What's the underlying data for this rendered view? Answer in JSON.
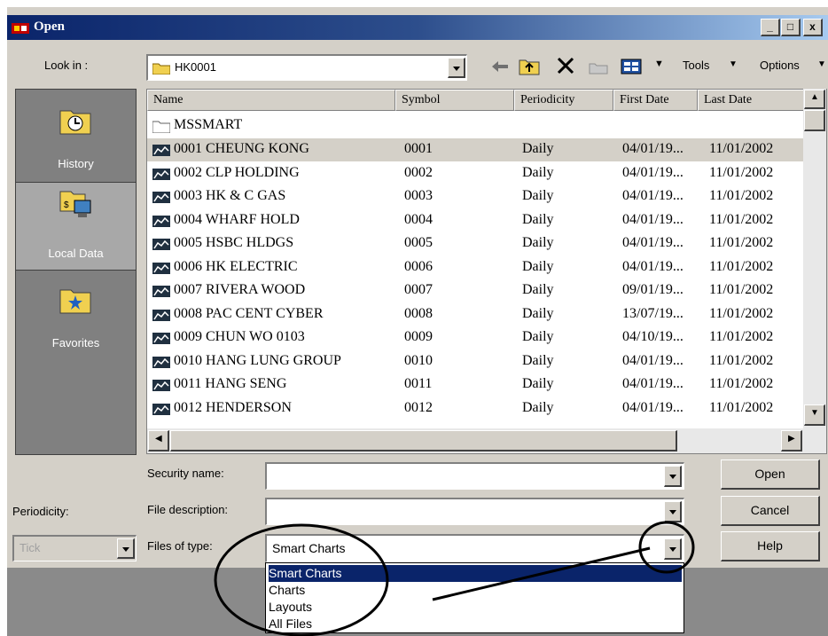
{
  "window": {
    "title": "Open"
  },
  "titlebar_buttons": {
    "minimize": "_",
    "maximize": "□",
    "close": "x"
  },
  "toolbar": {
    "look_in_label": "Look in :",
    "look_in_value": "HK0001",
    "tools_label": "Tools",
    "options_label": "Options"
  },
  "places": [
    {
      "label": "History",
      "icon": "history-icon"
    },
    {
      "label": "Local Data",
      "icon": "local-data-icon"
    },
    {
      "label": "Favorites",
      "icon": "favorites-icon"
    }
  ],
  "file_list": {
    "columns": [
      "Name",
      "Symbol",
      "Periodicity",
      "First Date",
      "Last Date"
    ],
    "folder": "MSSMART",
    "rows": [
      {
        "name": "0001 CHEUNG KONG",
        "symbol": "0001",
        "periodicity": "Daily",
        "first": "04/01/19...",
        "last": "11/01/2002",
        "selected": true
      },
      {
        "name": "0002 CLP HOLDING",
        "symbol": "0002",
        "periodicity": "Daily",
        "first": "04/01/19...",
        "last": "11/01/2002"
      },
      {
        "name": "0003 HK & C GAS",
        "symbol": "0003",
        "periodicity": "Daily",
        "first": "04/01/19...",
        "last": "11/01/2002"
      },
      {
        "name": "0004 WHARF HOLD",
        "symbol": "0004",
        "periodicity": "Daily",
        "first": "04/01/19...",
        "last": "11/01/2002"
      },
      {
        "name": "0005 HSBC HLDGS",
        "symbol": "0005",
        "periodicity": "Daily",
        "first": "04/01/19...",
        "last": "11/01/2002"
      },
      {
        "name": "0006 HK ELECTRIC",
        "symbol": "0006",
        "periodicity": "Daily",
        "first": "04/01/19...",
        "last": "11/01/2002"
      },
      {
        "name": "0007 RIVERA WOOD",
        "symbol": "0007",
        "periodicity": "Daily",
        "first": "09/01/19...",
        "last": "11/01/2002"
      },
      {
        "name": "0008 PAC CENT CYBER",
        "symbol": "0008",
        "periodicity": "Daily",
        "first": "13/07/19...",
        "last": "11/01/2002"
      },
      {
        "name": "0009 CHUN WO 0103",
        "symbol": "0009",
        "periodicity": "Daily",
        "first": "04/10/19...",
        "last": "11/01/2002"
      },
      {
        "name": "0010 HANG LUNG GROUP",
        "symbol": "0010",
        "periodicity": "Daily",
        "first": "04/01/19...",
        "last": "11/01/2002"
      },
      {
        "name": "0011 HANG SENG",
        "symbol": "0011",
        "periodicity": "Daily",
        "first": "04/01/19...",
        "last": "11/01/2002"
      },
      {
        "name": "0012 HENDERSON",
        "symbol": "0012",
        "periodicity": "Daily",
        "first": "04/01/19...",
        "last": "11/01/2002"
      }
    ]
  },
  "form": {
    "security_name_label": "Security name:",
    "security_name_value": "",
    "file_description_label": "File description:",
    "file_description_value": "",
    "files_of_type_label": "Files of type:",
    "files_of_type_value": "Smart Charts",
    "periodicity_label": "Periodicity:",
    "periodicity_value": "Tick"
  },
  "buttons": {
    "open": "Open",
    "cancel": "Cancel",
    "help": "Help"
  },
  "type_options": [
    "Smart Charts",
    "Charts",
    "Layouts",
    "All Files"
  ],
  "colors": {
    "title_start": "#0a246a",
    "title_end": "#a6caf0",
    "highlight": "#0a246a",
    "annotation": "#000000"
  }
}
